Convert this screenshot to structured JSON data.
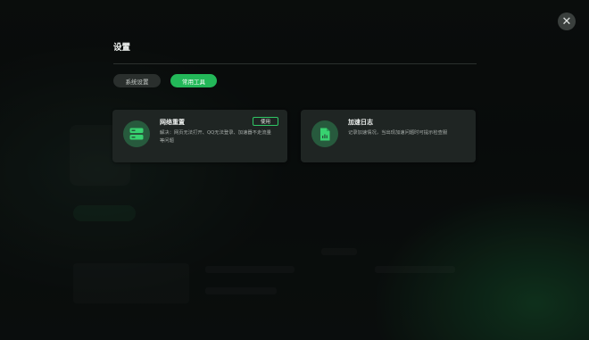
{
  "dialog": {
    "title": "设置",
    "close_icon": "close-icon"
  },
  "tabs": [
    {
      "label": "系统设置",
      "active": false
    },
    {
      "label": "常用工具",
      "active": true
    }
  ],
  "tools": [
    {
      "name": "网络重置",
      "description": "解决：网页无法打开、QQ无法登录、加速器不走流量等问题",
      "action_label": "使用",
      "icon": "network-reset-icon"
    },
    {
      "name": "加速日志",
      "description": "记录加速情况，当出现加速问题时可提示检查服",
      "icon": "log-file-icon"
    }
  ],
  "colors": {
    "accent": "#23b859",
    "card_bg": "#1f2523",
    "icon_bg": "#275a3d"
  }
}
